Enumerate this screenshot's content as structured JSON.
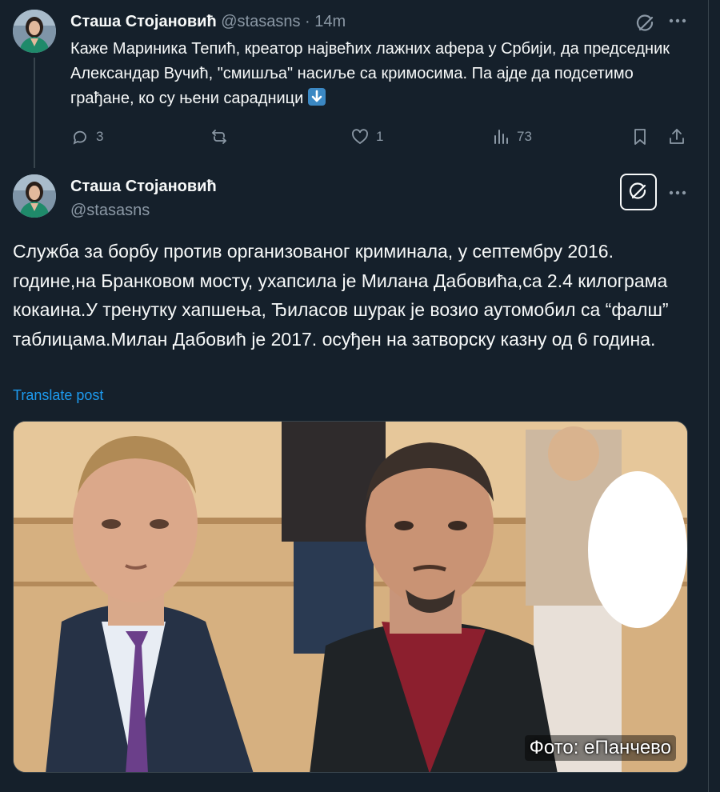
{
  "tweet1": {
    "display_name": "Сташа Стојановић",
    "handle": "@stasasns",
    "separator": "·",
    "time": "14m",
    "text": "Каже Мариника Тепић, креатор највећих лажних афера у Србији, да председник Александар Вучић, \"смишља\" насиље са кримосима. Па ајде да подсетимо грађане, ко су њени сарадници",
    "emoji_icon": "down-arrow-emoji-icon",
    "stats": {
      "replies": "3",
      "reposts": "",
      "likes": "1",
      "views": "73"
    }
  },
  "tweet2": {
    "display_name": "Сташа Стојановић",
    "handle": "@stasasns",
    "text": "Служба за борбу против организованог криминала, у септембру 2016. године,на Бранковом мосту, ухапсила је Милана Дабовића,са 2.4 килограма кокаина.У тренутку хапшења, Ђиласов шурак је возио аутомобил са “фалш” таблицама.Милан Дабовић је 2017. осуђен на затворску казну од 6 година.",
    "translate_label": "Translate post",
    "photo_credit": "Фото: еПанчево"
  },
  "icons": {
    "grok": "grok-icon",
    "more": "more-icon",
    "reply": "reply-icon",
    "repost": "repost-icon",
    "like": "like-icon",
    "views": "views-icon",
    "bookmark": "bookmark-icon",
    "share": "share-icon"
  },
  "colors": {
    "background": "#15202b",
    "text": "#f7f9f9",
    "secondary": "#8b98a5",
    "link": "#1d9bf0",
    "border": "#38444d"
  }
}
